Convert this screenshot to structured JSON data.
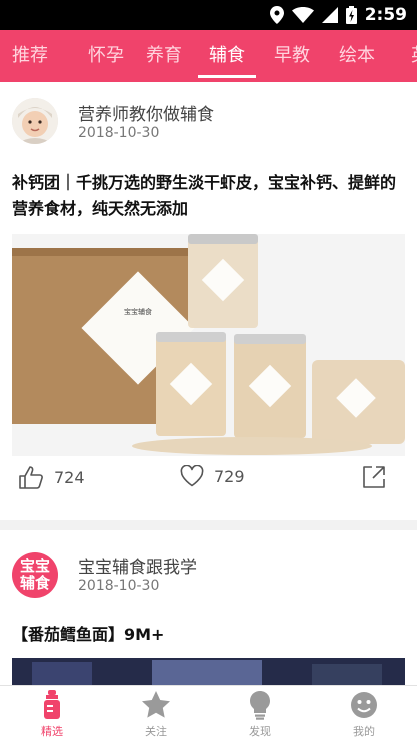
{
  "status": {
    "time": "2:59"
  },
  "top_tabs": [
    {
      "label": "推荐"
    },
    {
      "label": "怀孕"
    },
    {
      "label": "养育"
    },
    {
      "label": "辅食"
    },
    {
      "label": "早教"
    },
    {
      "label": "绘本"
    },
    {
      "label": "英"
    }
  ],
  "active_top_tab": "辅食",
  "posts": [
    {
      "author": "营养师教你做辅食",
      "date": "2018-10-30",
      "title": "补钙团｜千挑万选的野生淡干虾皮，宝宝补钙、提鲜的营养食材，纯天然无添加",
      "likes": "724",
      "favorites": "729",
      "image_label": "宝宝辅食"
    },
    {
      "author": "宝宝辅食跟我学",
      "avatar_text": "宝宝辅食",
      "date": "2018-10-30",
      "title": "【番茄鳕鱼面】9M+"
    }
  ],
  "bottom_nav": [
    {
      "label": "精选",
      "icon": "bottle-icon",
      "active": true
    },
    {
      "label": "关注",
      "icon": "star-icon",
      "active": false
    },
    {
      "label": "发现",
      "icon": "bulb-icon",
      "active": false
    },
    {
      "label": "我的",
      "icon": "smiley-icon",
      "active": false
    }
  ],
  "colors": {
    "brand": "#f0436b",
    "active_tab": "#ffffff",
    "inactive_tab": "#ffd4de"
  }
}
